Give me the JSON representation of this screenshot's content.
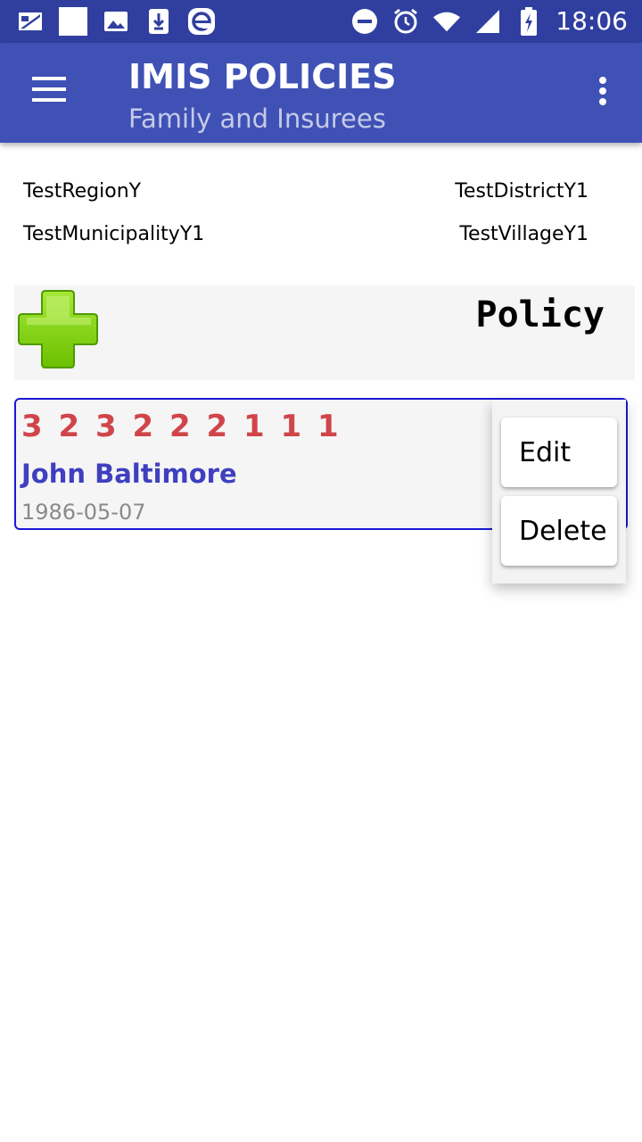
{
  "status_bar": {
    "time": "18:06",
    "left_icons": [
      "sim-card-icon",
      "square-icon",
      "image-icon",
      "download-icon",
      "e-icon"
    ],
    "right_icons": [
      "do-not-disturb-icon",
      "alarm-icon",
      "wifi-icon",
      "cell-signal-icon",
      "battery-charging-icon"
    ]
  },
  "toolbar": {
    "title": "IMIS POLICIES",
    "subtitle": "Family and Insurees",
    "menu_icon": "hamburger-menu-icon",
    "overflow_icon": "more-vertical-icon"
  },
  "location": {
    "region": "TestRegionY",
    "district": "TestDistrictY1",
    "municipality": "TestMunicipalityY1",
    "village": "TestVillageY1"
  },
  "policy_bar": {
    "add_icon": "green-plus-icon",
    "label": "Policy"
  },
  "insuree_card": {
    "number": "3 2 3 2 2 2 1 1 1",
    "name": "John Baltimore",
    "dob": "1986-05-07"
  },
  "context_menu": {
    "items": [
      "Edit",
      "Delete"
    ]
  },
  "colors": {
    "status_bar": "#303f9f",
    "toolbar": "#3f51b5",
    "subtitle": "#c5cae9",
    "number": "#d0454a",
    "name": "#3f3fbf",
    "card_border": "#1a1ad6"
  }
}
